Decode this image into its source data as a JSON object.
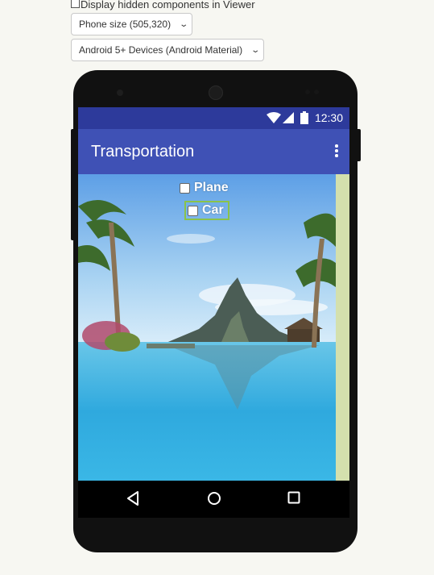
{
  "viewer": {
    "hidden_components_label": "Display hidden components in Viewer",
    "hidden_components_checked": false,
    "phone_size": "Phone size (505,320)",
    "theme": "Android 5+ Devices (Android Material)"
  },
  "status_bar": {
    "time": "12:30"
  },
  "app_bar": {
    "title": "Transportation"
  },
  "checkboxes": [
    {
      "label": "Plane",
      "checked": false
    },
    {
      "label": "Car",
      "checked": false
    }
  ],
  "colors": {
    "status_bar": "#2d3a9b",
    "app_bar": "#3f51b5",
    "content_background": "#d4e0ad",
    "selection_outline": "#8bc34a"
  },
  "icons": [
    "wifi-icon",
    "signal-icon",
    "battery-icon",
    "overflow-menu-icon",
    "back-icon",
    "home-icon",
    "recents-icon"
  ]
}
